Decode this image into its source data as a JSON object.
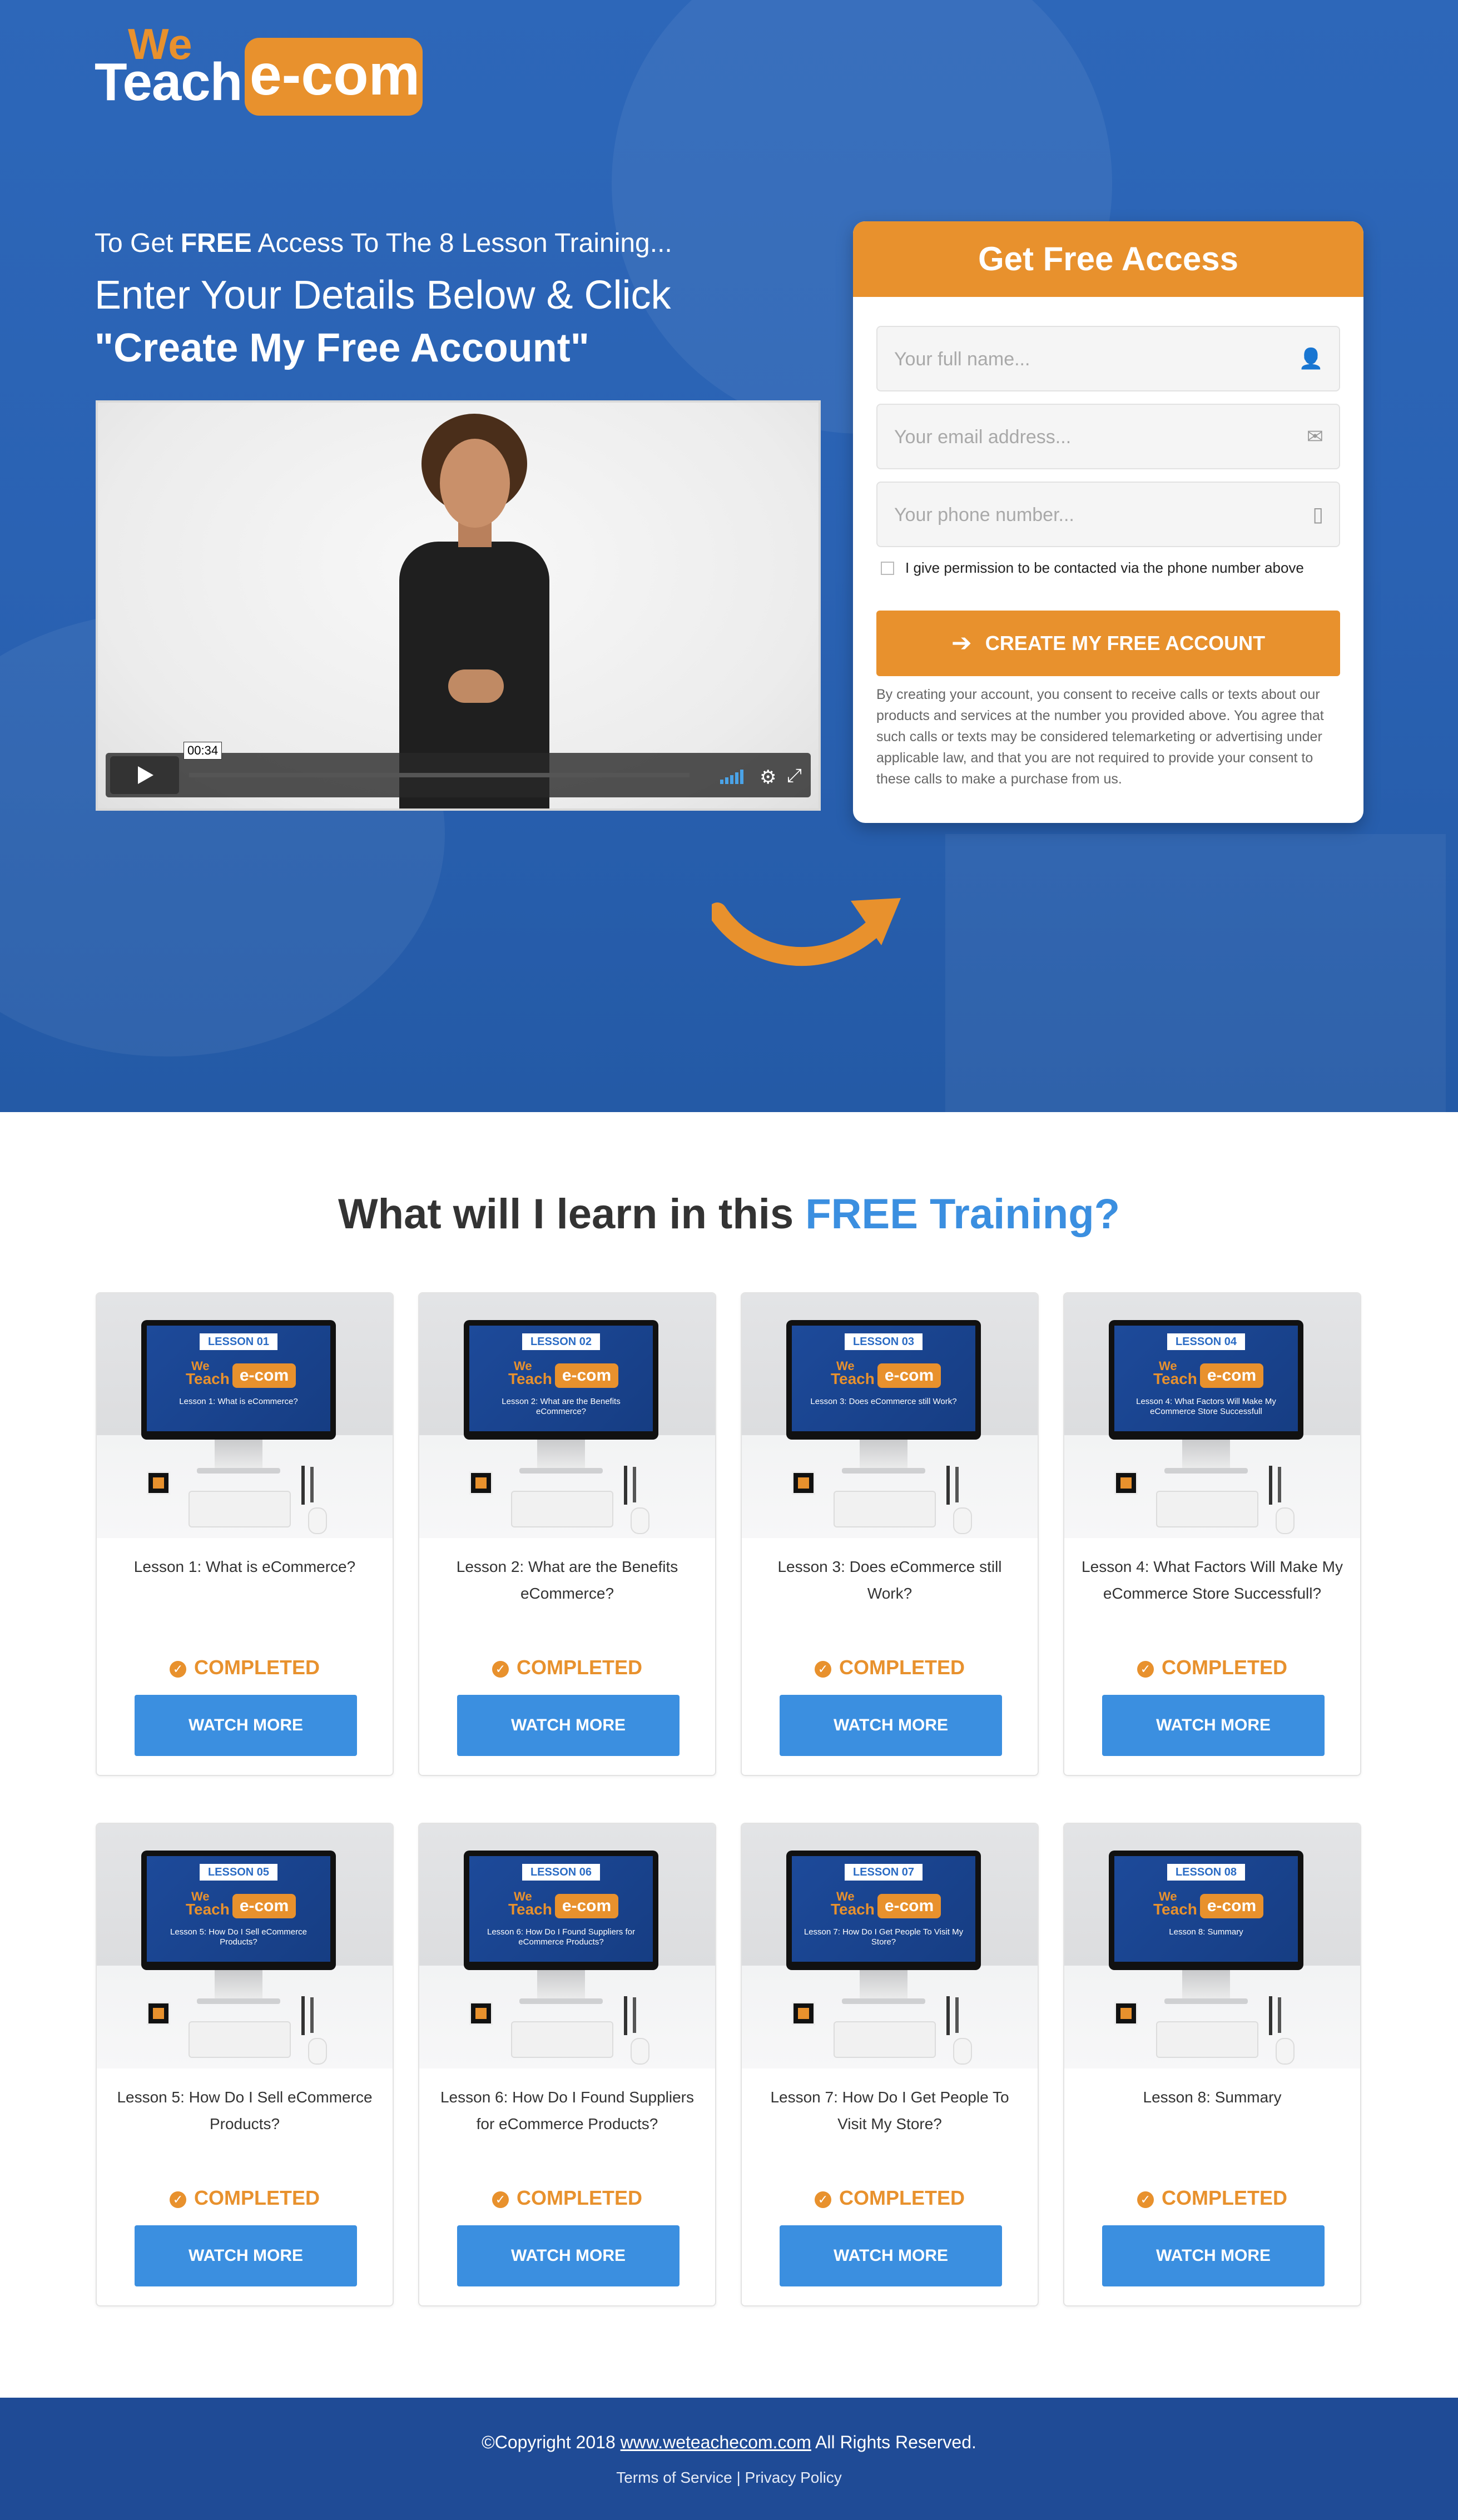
{
  "brand": {
    "we": "We",
    "teach": "Teach",
    "ecom": "e-com"
  },
  "hero": {
    "line1_prefix": "To Get ",
    "line1_bold": "FREE",
    "line1_suffix": " Access To The 8 Lesson Training...",
    "line2": "Enter Your Details Below & Click",
    "line3": "\"Create My Free Account\""
  },
  "video": {
    "timecode": "00:34",
    "play_icon": "play-icon",
    "settings_icon": "gear-icon",
    "fullscreen_icon": "fullscreen-icon"
  },
  "form": {
    "title": "Get Free Access",
    "name_placeholder": "Your full name...",
    "email_placeholder": "Your email address...",
    "phone_placeholder": "Your phone number...",
    "consent_label": "I give permission to be contacted via the phone number above",
    "submit_label": "CREATE MY FREE ACCOUNT",
    "disclaimer": "By creating your account, you consent to receive calls or texts about our products and services at the number you provided above. You agree that such calls or texts may be considered telemarketing or advertising under applicable law, and that you are not required to provide your consent to these calls to make a purchase from us."
  },
  "lessons_section": {
    "title_prefix": "What will I learn in this ",
    "title_highlight": "FREE Training?"
  },
  "lessons": [
    {
      "tag": "LESSON 01",
      "screen": "Lesson 1: What is eCommerce?",
      "title": "Lesson 1: What is eCommerce?",
      "status": "COMPLETED",
      "button": "WATCH MORE"
    },
    {
      "tag": "LESSON 02",
      "screen": "Lesson 2: What are the Benefits eCommerce?",
      "title": "Lesson 2: What are the Benefits eCommerce?",
      "status": "COMPLETED",
      "button": "WATCH MORE"
    },
    {
      "tag": "LESSON 03",
      "screen": "Lesson 3: Does eCommerce still Work?",
      "title": "Lesson 3: Does eCommerce still Work?",
      "status": "COMPLETED",
      "button": "WATCH MORE"
    },
    {
      "tag": "LESSON 04",
      "screen": "Lesson 4: What Factors Will Make My eCommerce Store Successfull",
      "title": "Lesson 4: What Factors Will Make My eCommerce Store Successfull?",
      "status": "COMPLETED",
      "button": "WATCH MORE"
    },
    {
      "tag": "LESSON 05",
      "screen": "Lesson 5: How Do I Sell eCommerce Products?",
      "title": "Lesson 5: How Do I Sell eCommerce Products?",
      "status": "COMPLETED",
      "button": "WATCH MORE"
    },
    {
      "tag": "LESSON 06",
      "screen": "Lesson 6: How Do I Found Suppliers for eCommerce Products?",
      "title": "Lesson 6: How Do I Found Suppliers for eCommerce Products?",
      "status": "COMPLETED",
      "button": "WATCH MORE"
    },
    {
      "tag": "LESSON 07",
      "screen": "Lesson 7: How Do I Get People To Visit My Store?",
      "title": "Lesson 7: How Do I Get People To Visit My Store?",
      "status": "COMPLETED",
      "button": "WATCH MORE"
    },
    {
      "tag": "LESSON 08",
      "screen": "Lesson 8: Summary",
      "title": "Lesson 8: Summary",
      "status": "COMPLETED",
      "button": "WATCH MORE"
    }
  ],
  "footer": {
    "copyright_prefix": "©Copyright 2018 ",
    "site_link": "www.weteachecom.com",
    "copyright_suffix": " All Rights Reserved.",
    "terms": "Terms of Service",
    "separator": " | ",
    "privacy": "Privacy Policy"
  },
  "colors": {
    "hero_blue": "#2a62b3",
    "brand_orange": "#e8912d",
    "action_blue": "#3b8fe0",
    "footer_blue": "#1f4b96"
  }
}
